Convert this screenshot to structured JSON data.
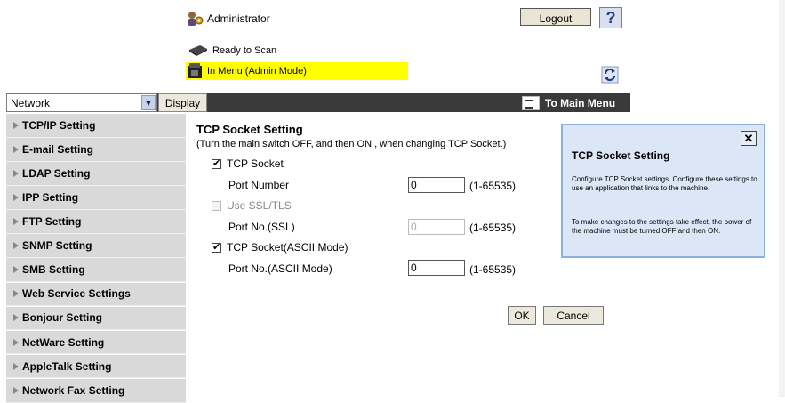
{
  "header": {
    "user": "Administrator",
    "logout_label": "Logout",
    "help_label": "?",
    "status": "Ready to Scan",
    "mode": "In Menu (Admin Mode)"
  },
  "toolbar": {
    "category_value": "Network",
    "display_label": "Display",
    "main_menu_label": "To Main Menu"
  },
  "sidebar": {
    "items": [
      {
        "label": "TCP/IP Setting"
      },
      {
        "label": "E-mail Setting"
      },
      {
        "label": "LDAP Setting"
      },
      {
        "label": "IPP Setting"
      },
      {
        "label": "FTP Setting"
      },
      {
        "label": "SNMP Setting"
      },
      {
        "label": "SMB Setting"
      },
      {
        "label": "Web Service Settings"
      },
      {
        "label": "Bonjour Setting"
      },
      {
        "label": "NetWare Setting"
      },
      {
        "label": "AppleTalk Setting"
      },
      {
        "label": "Network Fax Setting"
      }
    ]
  },
  "form": {
    "title": "TCP Socket Setting",
    "note": "(Turn the main switch OFF, and then ON , when changing TCP Socket.)",
    "tcp_socket_label": "TCP Socket",
    "port_number_label": "Port Number",
    "port_number_value": "0",
    "range": "(1-65535)",
    "ssl_label": "Use SSL/TLS",
    "port_ssl_label": "Port No.(SSL)",
    "port_ssl_value": "0",
    "ascii_label": "TCP Socket(ASCII Mode)",
    "port_ascii_label": "Port No.(ASCII Mode)",
    "port_ascii_value": "0",
    "ok_label": "OK",
    "cancel_label": "Cancel"
  },
  "help_panel": {
    "close_label": "✕",
    "title": "TCP Socket Setting",
    "p1": "Configure TCP Socket settings. Configure these settings to use an application that links to the machine.",
    "p2": "To make changes to the settings take effect, the power of the machine must be turned OFF and then ON."
  }
}
